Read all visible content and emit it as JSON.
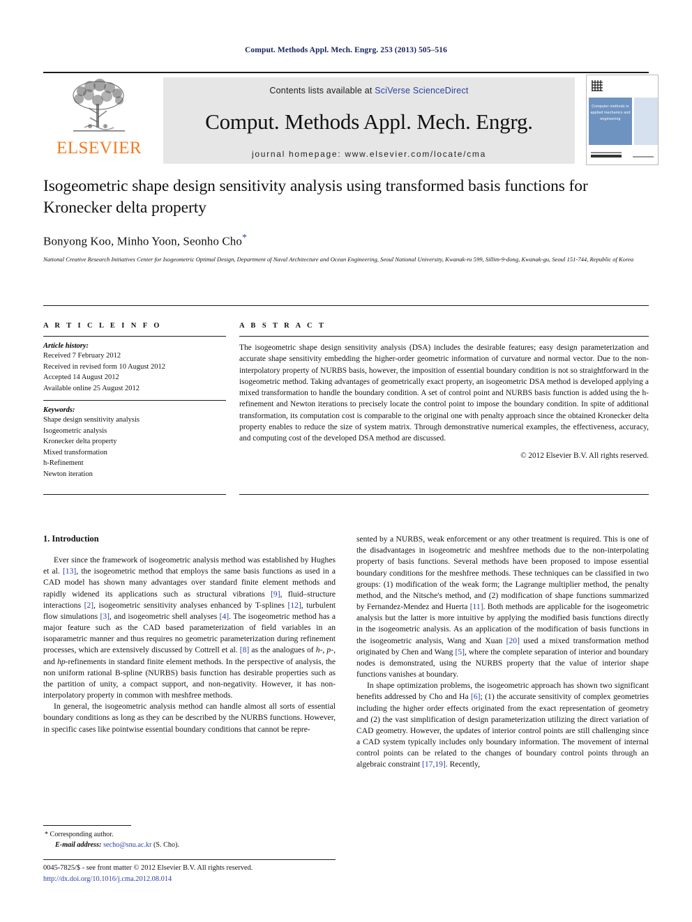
{
  "running_head": "Comput. Methods Appl. Mech. Engrg. 253 (2013) 505–516",
  "masthead": {
    "publisher_name": "ELSEVIER",
    "contents_prefix": "Contents lists available at ",
    "contents_link": "SciVerse ScienceDirect",
    "journal_title": "Comput. Methods Appl. Mech. Engrg.",
    "homepage_line": "journal homepage: www.elsevier.com/locate/cma",
    "cover_title": "Computer methods in applied mechanics and engineering",
    "accent_orange": "#F47B20",
    "link_blue": "#2b3fa0",
    "band_grey": "#e6e6e6",
    "cover_blue": "#6f93c0"
  },
  "article": {
    "title": "Isogeometric shape design sensitivity analysis using transformed basis functions for Kronecker delta property",
    "authors": "Bonyong Koo, Minho Yoon, Seonho Cho",
    "corresponding_marker": "*",
    "affiliation": "National Creative Research Initiatives Center for Isogeometric Optimal Design, Department of Naval Architecture and Ocean Engineering, Seoul National University, Kwanak-ro 599, Sillim-9-dong, Kwanak-gu, Seoul 151-744, Republic of Korea"
  },
  "article_info": {
    "section_label": "A R T I C L E   I N F O",
    "history_label": "Article history:",
    "history": [
      "Received 7 February 2012",
      "Received in revised form 10 August 2012",
      "Accepted 14 August 2012",
      "Available online 25 August 2012"
    ],
    "keywords_label": "Keywords:",
    "keywords": [
      "Shape design sensitivity analysis",
      "Isogeometric analysis",
      "Kronecker delta property",
      "Mixed transformation",
      "h-Refinement",
      "Newton iteration"
    ]
  },
  "abstract": {
    "section_label": "A B S T R A C T",
    "text": "The isogeometric shape design sensitivity analysis (DSA) includes the desirable features; easy design parameterization and accurate shape sensitivity embedding the higher-order geometric information of curvature and normal vector. Due to the non-interpolatory property of NURBS basis, however, the imposition of essential boundary condition is not so straightforward in the isogeometric method. Taking advantages of geometrically exact property, an isogeometric DSA method is developed applying a mixed transformation to handle the boundary condition. A set of control point and NURBS basis function is added using the h-refinement and Newton iterations to precisely locate the control point to impose the boundary condition. In spite of additional transformation, its computation cost is comparable to the original one with penalty approach since the obtained Kronecker delta property enables to reduce the size of system matrix. Through demonstrative numerical examples, the effectiveness, accuracy, and computing cost of the developed DSA method are discussed.",
    "copyright": "© 2012 Elsevier B.V. All rights reserved."
  },
  "body": {
    "section_heading": "1. Introduction",
    "left_paragraph_1_a": "Ever since the framework of isogeometric analysis method was established by Hughes et al. ",
    "left_ref_13": "[13]",
    "left_paragraph_1_b": ", the isogeometric method that employs the same basis functions as used in a CAD model has shown many advantages over standard finite element methods and rapidly widened its applications such as structural vibrations ",
    "left_ref_9": "[9]",
    "left_paragraph_1_c": ", fluid–structure interactions ",
    "left_ref_2": "[2]",
    "left_paragraph_1_d": ", isogeometric sensitivity analyses enhanced by T-splines ",
    "left_ref_12": "[12]",
    "left_paragraph_1_e": ", turbulent flow simulations ",
    "left_ref_3": "[3]",
    "left_paragraph_1_f": ", and isogeometric shell analyses ",
    "left_ref_4": "[4]",
    "left_paragraph_1_g": ". The isogeometric method has a major feature such as the CAD based parameterization of field variables in an isoparametric manner and thus requires no geometric parameterization during refinement processes, which are extensively discussed by Cottrell et al. ",
    "left_ref_8": "[8]",
    "left_paragraph_1_h": " as the analogues of ",
    "left_italic_hp1": "h-",
    "left_paragraph_1_i": ", ",
    "left_italic_p": "p-",
    "left_paragraph_1_j": ", and ",
    "left_italic_hp2": "hp",
    "left_paragraph_1_k": "-refinements in standard finite element methods. In the perspective of analysis, the non uniform rational B-spline (NURBS) basis function has desirable properties such as the partition of unity, a compact support, and non-negativity. However, it has non-interpolatory property in common with meshfree methods.",
    "left_paragraph_2": "In general, the isogeometric analysis method can handle almost all sorts of essential boundary conditions as long as they can be described by the NURBS functions. However, in specific cases like pointwise essential boundary conditions that cannot be repre-",
    "right_paragraph_1_a": "sented by a NURBS, weak enforcement or any other treatment is required. This is one of the disadvantages in isogeometric and meshfree methods due to the non-interpolating property of basis functions. Several methods have been proposed to impose essential boundary conditions for the meshfree methods. These techniques can be classified in two groups: (1) modification of the weak form; the Lagrange multiplier method, the penalty method, and the Nitsche's method, and (2) modification of shape functions summarized by Fernandez-Mendez and Huerta ",
    "right_ref_11": "[11]",
    "right_paragraph_1_b": ". Both methods are applicable for the isogeometric analysis but the latter is more intuitive by applying the modified basis functions directly in the isogeometric analysis. As an application of the modification of basis functions in the isogeometric analysis, Wang and Xuan ",
    "right_ref_20": "[20]",
    "right_paragraph_1_c": " used a mixed transformation method originated by Chen and Wang ",
    "right_ref_5": "[5]",
    "right_paragraph_1_d": ", where the complete separation of interior and boundary nodes is demonstrated, using the NURBS property that the value of interior shape functions vanishes at boundary.",
    "right_paragraph_2_a": "In shape optimization problems, the isogeometric approach has shown two significant benefits addressed by Cho and Ha ",
    "right_ref_6": "[6]",
    "right_paragraph_2_b": "; (1) the accurate sensitivity of complex geometries including the higher order effects originated from the exact representation of geometry and (2) the vast simplification of design parameterization utilizing the direct variation of CAD geometry. However, the updates of interior control points are still challenging since a CAD system typically includes only boundary information. The movement of internal control points can be related to the changes of boundary control points through an algebraic constraint ",
    "right_ref_1719": "[17,19]",
    "right_paragraph_2_c": ". Recently,"
  },
  "footnote": {
    "corresponding_star": "*",
    "corresponding_text": "Corresponding author.",
    "email_label": "E-mail address:",
    "email": "secho@snu.ac.kr",
    "email_owner": "(S. Cho)."
  },
  "footer": {
    "issn_line": "0045-7825/$ - see front matter © 2012 Elsevier B.V. All rights reserved.",
    "doi": "http://dx.doi.org/10.1016/j.cma.2012.08.014"
  }
}
